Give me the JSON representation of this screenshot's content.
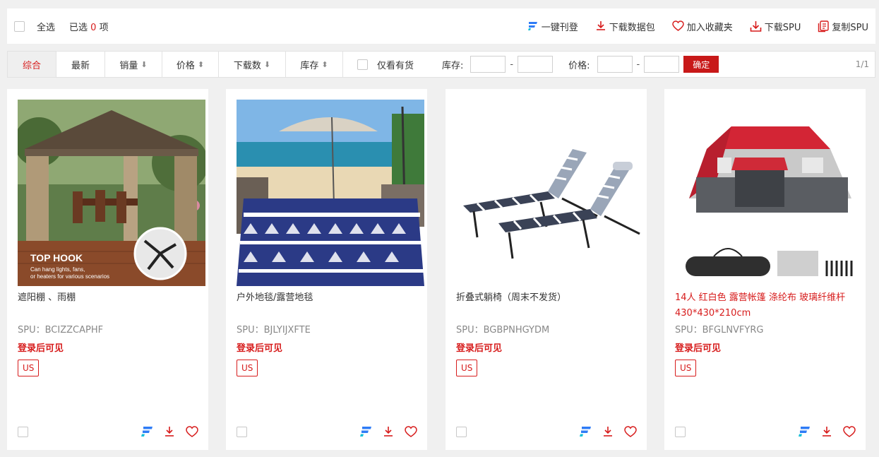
{
  "toolbar": {
    "select_all": "全选",
    "selected_prefix": "已选",
    "selected_count": "0",
    "selected_suffix": "项",
    "actions": [
      {
        "label": "一键刊登",
        "icon": "publish-icon"
      },
      {
        "label": "下载数据包",
        "icon": "download-icon"
      },
      {
        "label": "加入收藏夹",
        "icon": "heart-icon"
      },
      {
        "label": "下载SPU",
        "icon": "download-tray-icon"
      },
      {
        "label": "复制SPU",
        "icon": "copy-icon"
      }
    ]
  },
  "filters": {
    "tabs": [
      {
        "label": "综合",
        "arrow": ""
      },
      {
        "label": "最新",
        "arrow": ""
      },
      {
        "label": "销量",
        "arrow": "⬇"
      },
      {
        "label": "价格",
        "arrow": "⬍"
      },
      {
        "label": "下载数",
        "arrow": "⬇"
      },
      {
        "label": "库存",
        "arrow": "⬍"
      }
    ],
    "in_stock_only": "仅看有货",
    "stock_label": "库存:",
    "price_label": "价格:",
    "range_dash": "-",
    "confirm": "确定",
    "page": "1/1"
  },
  "products": [
    {
      "title": "遮阳棚 、雨棚",
      "title_red": false,
      "spu": "SPU：BCIZZCAPHF",
      "price_text": "登录后可见",
      "tag": "US",
      "image_text": {
        "headline": "TOP HOOK",
        "line1": "Can hang lights, fans,",
        "line2": "or heaters for various scenarios"
      }
    },
    {
      "title": "户外地毯/露营地毯",
      "title_red": false,
      "spu": "SPU：BJLYIJXFTE",
      "price_text": "登录后可见",
      "tag": "US"
    },
    {
      "title": "折叠式躺椅（周末不发货）",
      "title_red": false,
      "spu": "SPU：BGBPNHGYDM",
      "price_text": "登录后可见",
      "tag": "US"
    },
    {
      "title": "14人 红白色 露营帐篷 涤纶布 玻璃纤维杆 430*430*210cm",
      "title_red": true,
      "spu": "SPU：BFGLNVFYRG",
      "price_text": "登录后可见",
      "tag": "US"
    }
  ],
  "colors": {
    "accent": "#d71c1c",
    "confirm_bg": "#c81919",
    "publish_blue": "#2f7cf6",
    "publish_cyan": "#19c0d8"
  }
}
